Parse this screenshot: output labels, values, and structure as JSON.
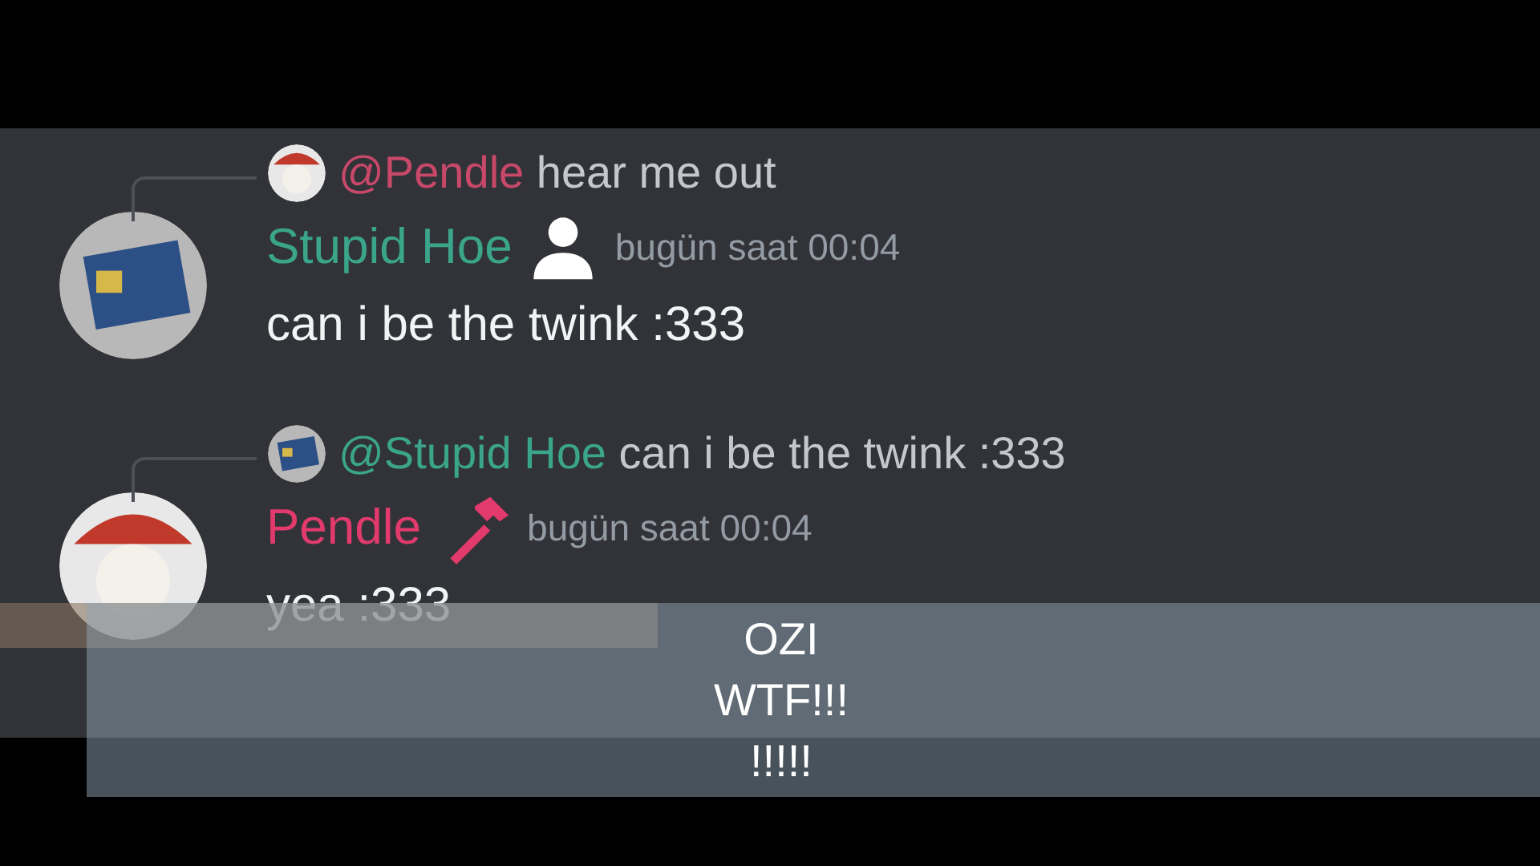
{
  "messages": [
    {
      "reply": {
        "mention": "@Pendle",
        "color": "#c8486a",
        "text": "hear me out"
      },
      "author": "Stupid Hoe",
      "color": "#3aa58a",
      "kind": "person",
      "timestamp": "bugün saat 00:04",
      "text": "can i be the twink :333"
    },
    {
      "reply": {
        "mention": "@Stupid Hoe",
        "color": "#3aa58a",
        "text": "can i be the twink :333"
      },
      "author": "Pendle",
      "color": "#e23a6c",
      "kind": "hammer",
      "timestamp": "bugün saat 00:04",
      "text": "yea :333"
    }
  ],
  "caption": [
    "OZI",
    "WTF!!!",
    "!!!!!"
  ]
}
